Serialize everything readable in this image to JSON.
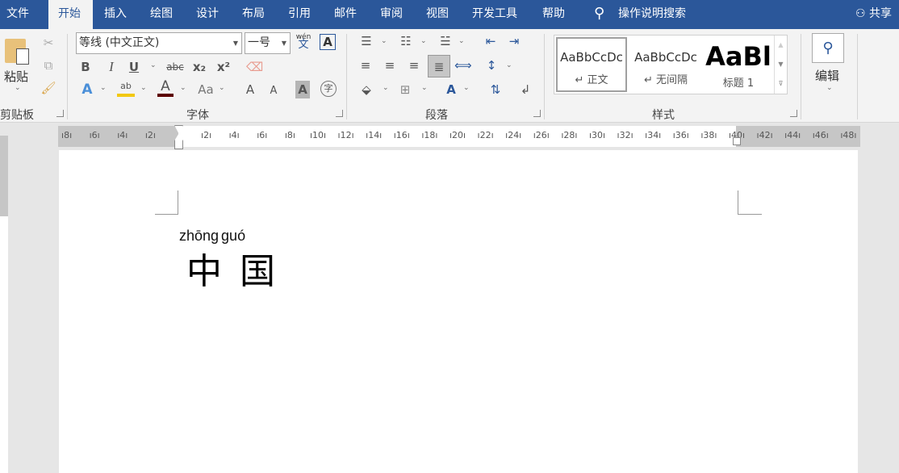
{
  "tabs": [
    "文件",
    "开始",
    "插入",
    "绘图",
    "设计",
    "布局",
    "引用",
    "邮件",
    "审阅",
    "视图",
    "开发工具",
    "帮助"
  ],
  "active_tab": "开始",
  "search_label": "操作说明搜索",
  "share_label": "共享",
  "clipboard": {
    "paste": "粘贴",
    "group": "剪贴板"
  },
  "font": {
    "name": "等线 (中文正文)",
    "size": "一号",
    "group": "字体",
    "phonetic_top": "wén",
    "phonetic_bottom": "文",
    "bold": "B",
    "italic": "I",
    "underline": "U",
    "strike": "abc",
    "sub": "x₂",
    "sup": "x²",
    "case": "Aa",
    "grow": "A",
    "shrink": "A",
    "shade": "A",
    "enclose": "字",
    "effects": "A",
    "color": "A",
    "highlight": "ab",
    "border_char": "A"
  },
  "paragraph": {
    "group": "段落"
  },
  "styles": {
    "group": "样式",
    "items": [
      {
        "preview": "AaBbCcDc",
        "name": "↵ 正文"
      },
      {
        "preview": "AaBbCcDc",
        "name": "↵ 无间隔"
      },
      {
        "preview": "AaBl",
        "name": "标题 1"
      }
    ]
  },
  "editing": {
    "label": "编辑"
  },
  "ruler": {
    "left": [
      "8",
      "6",
      "4",
      "2"
    ],
    "right": [
      "2",
      "4",
      "6",
      "8",
      "10",
      "12",
      "14",
      "16",
      "18",
      "20",
      "22",
      "24",
      "26",
      "28",
      "30",
      "32",
      "34",
      "36",
      "38",
      "40",
      "42",
      "44",
      "46",
      "48"
    ]
  },
  "document": {
    "pinyin": "zhōng guó",
    "text": "中 国"
  },
  "colors": {
    "brand": "#2b579a",
    "highlight": "#f2c811",
    "font_color": "#5c0000"
  }
}
